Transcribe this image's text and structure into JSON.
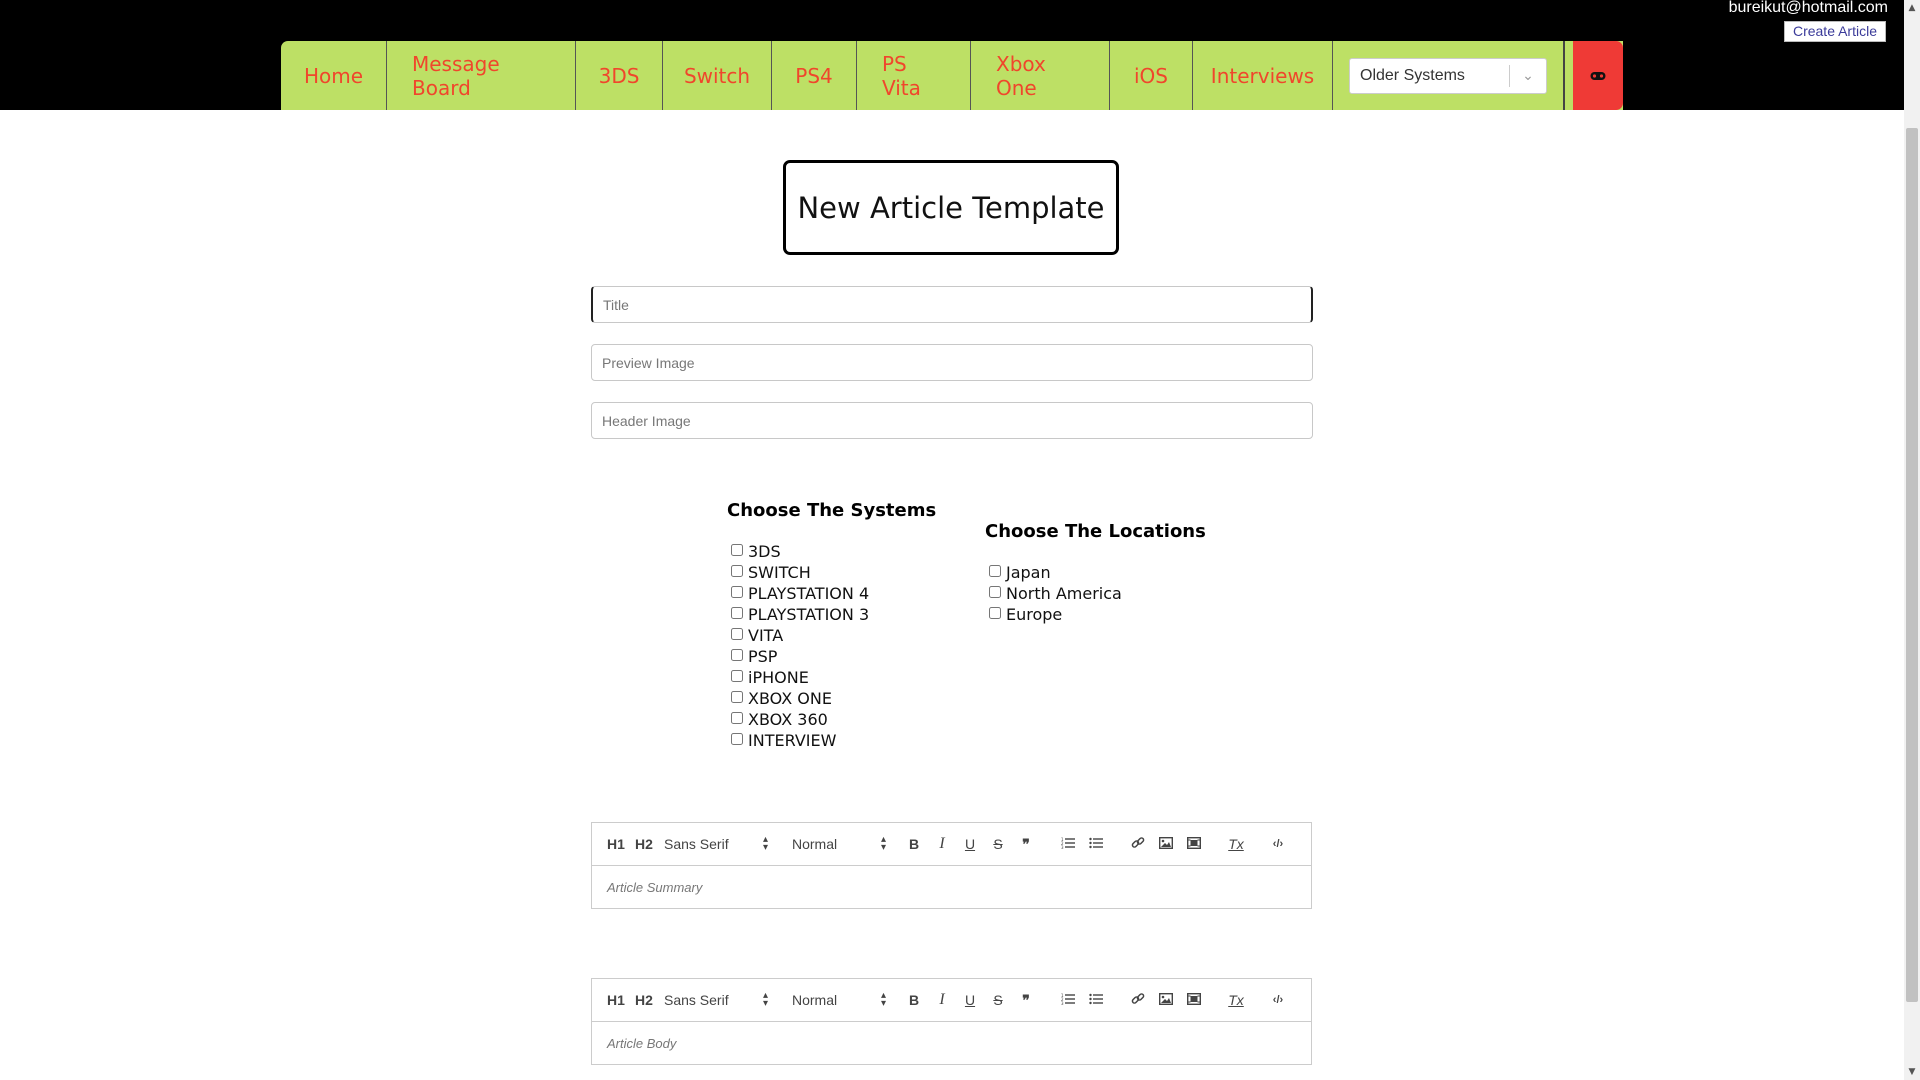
{
  "header": {
    "user_email": "bureikut@hotmail.com",
    "create_article": "Create Article",
    "nav": [
      "Home",
      "Message Board",
      "3DS",
      "Switch",
      "PS4",
      "PS Vita",
      "Xbox One",
      "iOS",
      "Interviews"
    ],
    "older_systems": "Older Systems",
    "accent_green": "#bde065",
    "accent_red": "#ef3a36",
    "nav_text_color": "#f0462c"
  },
  "form": {
    "heading": "New Article Template",
    "title_placeholder": "Title",
    "preview_placeholder": "Preview Image",
    "header_placeholder": "Header Image"
  },
  "systems": {
    "heading": "Choose The Systems",
    "items": [
      "3DS",
      "SWITCH",
      "PLAYSTATION 4",
      "PLAYSTATION 3",
      "VITA",
      "PSP",
      "iPHONE",
      "XBOX ONE",
      "XBOX 360",
      "INTERVIEW"
    ]
  },
  "locations": {
    "heading": "Choose The Locations",
    "items": [
      "Japan",
      "North America",
      "Europe"
    ]
  },
  "editor_toolbar": {
    "h1": "H1",
    "h2": "H2",
    "font": "Sans Serif",
    "size": "Normal",
    "bold": "B",
    "italic": "I",
    "underline": "U",
    "strike": "S",
    "quote": "❞",
    "clean": "Tx",
    "code": "‹/›"
  },
  "summary_placeholder": "Article Summary",
  "body_placeholder": "Article Body"
}
